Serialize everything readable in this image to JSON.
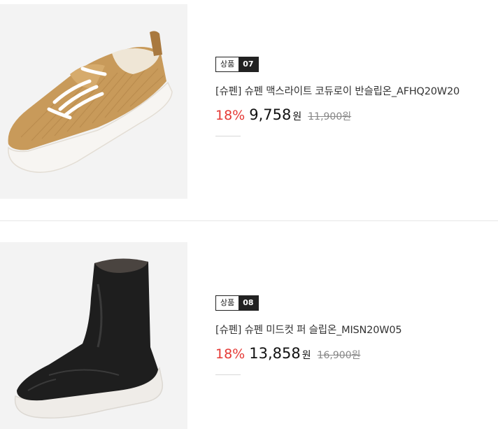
{
  "products": [
    {
      "badge_label": "상품",
      "badge_number": "07",
      "name": "[슈펜] 슈펜 맥스라이트 코듀로이 반슬립온_AFHQ20W20",
      "discount": "18%",
      "price": "9,758",
      "currency": "원",
      "original_price": "11,900",
      "original_currency": "원",
      "image": "tan-corduroy-sneaker"
    },
    {
      "badge_label": "상품",
      "badge_number": "08",
      "name": "[슈펜] 슈펜 미드컷 퍼 슬립온_MISN20W05",
      "discount": "18%",
      "price": "13,858",
      "currency": "원",
      "original_price": "16,900",
      "original_currency": "원",
      "image": "black-mid-cut-fur-boot"
    }
  ],
  "colors": {
    "discount": "#e53935",
    "badge_dark": "#222222",
    "thumb_bg": "#f3f3f3"
  }
}
